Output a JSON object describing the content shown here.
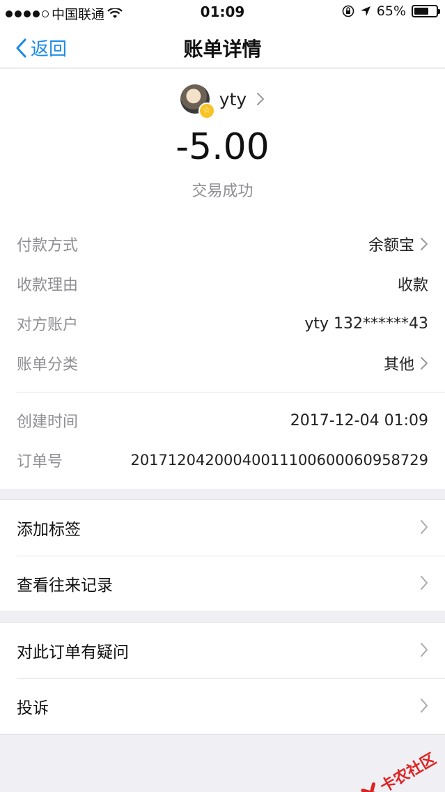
{
  "status_bar": {
    "carrier": "中国联通",
    "time": "01:09",
    "battery": "65%",
    "battery_level": 0.65
  },
  "nav": {
    "back_label": "返回",
    "title": "账单详情"
  },
  "header": {
    "payee_name": "yty",
    "amount": "-5.00",
    "status": "交易成功"
  },
  "details": [
    {
      "label": "付款方式",
      "value": "余额宝",
      "chevron": true
    },
    {
      "label": "收款理由",
      "value": "收款",
      "chevron": false
    },
    {
      "label": "对方账户",
      "value": "yty 132******43",
      "chevron": false
    },
    {
      "label": "账单分类",
      "value": "其他",
      "chevron": true
    }
  ],
  "meta": [
    {
      "label": "创建时间",
      "value": "2017-12-04 01:09"
    },
    {
      "label": "订单号",
      "value": "20171204200040011100600060958729"
    }
  ],
  "actions_1": [
    {
      "label": "添加标签"
    },
    {
      "label": "查看往来记录"
    }
  ],
  "actions_2": [
    {
      "label": "对此订单有疑问"
    },
    {
      "label": "投诉"
    }
  ],
  "watermark": "卡农社区",
  "colors": {
    "accent": "#1a8ae6",
    "muted": "#8e8e93",
    "background": "#f0f0f4"
  }
}
